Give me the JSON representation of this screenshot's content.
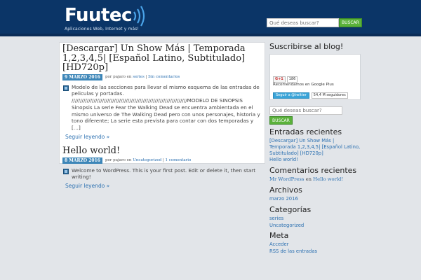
{
  "header": {
    "logo_text": "Fuutec",
    "tagline": "Aplicaciones Web, Internet y más!",
    "search_placeholder": "Qué deseas buscar?",
    "search_button": "BUSCAR"
  },
  "posts": [
    {
      "title": "[Descargar] Un Show Más | Temporada 1,2,3,4,5| [Español Latino, Subtitulado] [HD720p]",
      "date": "9 MARZO 2016",
      "by": "por",
      "author": "pajaro",
      "in": "en",
      "category": "series",
      "sep": "|",
      "comments": "Sin comentarios",
      "excerpt": "Modelo de las secciones para llevar el mismo esquema de las entradas de peliculas y portadas. ////////////////////////////////////////////////////////////////////MODELO DE SINOPSIS Sinopsis La serie Fear the Walking Dead se encuentra ambientada en el mismo universo de The Walking Dead pero con unos personajes, historia y tono diferente; La serie esta prevista para contar con dos temporadas y […]",
      "read_more": "Seguir leyendo »"
    },
    {
      "title": "Hello world!",
      "date": "8 MARZO 2016",
      "by": "por",
      "author": "pajaro",
      "in": "en",
      "category": "Uncategorized",
      "sep": "|",
      "comments": "1 comentario",
      "excerpt": "Welcome to WordPress. This is your first post. Edit or delete it, then start writing!",
      "read_more": "Seguir leyendo »"
    }
  ],
  "sidebar": {
    "subscribe_title": "Suscribirse al blog!",
    "gplus_button": "G+1",
    "gplus_count": "186",
    "gplus_text": "Recomendamos en Google Plus",
    "twitter_button": "Seguir a @twitter",
    "twitter_count": "54,4 M seguidores",
    "search_placeholder": "Qué deseas buscar?",
    "search_button": "BUSCAR",
    "recent_posts_title": "Entradas recientes",
    "recent_posts": [
      "[Descargar] Un Show Más | Temporada 1,2,3,4,5| [Español Latino, Subtitulado] [HD720p]",
      "Hello world!"
    ],
    "recent_comments_title": "Comentarios recientes",
    "recent_comment": {
      "author": "Mr WordPress",
      "on": "en",
      "post": "Hello world!"
    },
    "archives_title": "Archivos",
    "archives": [
      "marzo 2016"
    ],
    "categories_title": "Categorías",
    "categories": [
      "series",
      "Uncategorized"
    ],
    "meta_title": "Meta",
    "meta": [
      "Acceder",
      "RSS de las entradas"
    ]
  },
  "colors": {
    "header_bg": "#0b3567",
    "page_bg": "#e2e5e9",
    "date_badge": "#3d86b8",
    "link": "#2a6fb0",
    "search_button": "#5ab13a"
  },
  "icons": {
    "logo": "sound-waves-icon",
    "post_thumb": "page-thumbnail-icon"
  }
}
